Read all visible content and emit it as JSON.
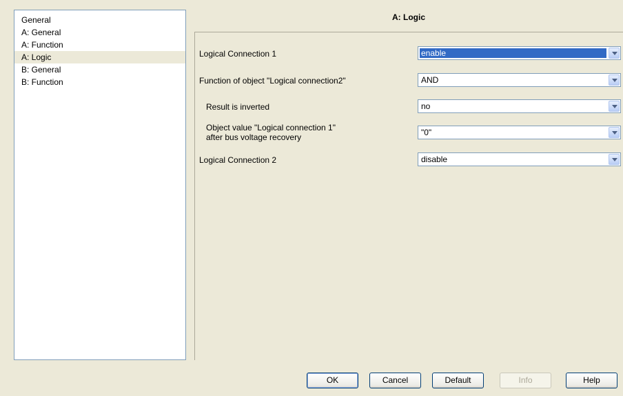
{
  "tree": {
    "items": [
      {
        "label": "General",
        "selected": false
      },
      {
        "label": "A: General",
        "selected": false
      },
      {
        "label": "A: Function",
        "selected": false
      },
      {
        "label": "A: Logic",
        "selected": true
      },
      {
        "label": "B: General",
        "selected": false
      },
      {
        "label": "B: Function",
        "selected": false
      }
    ]
  },
  "panel": {
    "title": "A: Logic",
    "params": [
      {
        "label": "Logical Connection 1",
        "value": "enable",
        "highlighted": true
      },
      {
        "label": "Function of object \"Logical connection2\"",
        "value": "AND"
      },
      {
        "label": "Result is inverted",
        "value": "no"
      },
      {
        "label_line1": "Object value \"Logical connection 1\"",
        "label_line2": "after bus voltage recovery",
        "value": "\"0\""
      },
      {
        "label": "Logical Connection 2",
        "value": "disable"
      }
    ]
  },
  "buttons": {
    "ok": "OK",
    "cancel": "Cancel",
    "default": "Default",
    "info": "Info",
    "help": "Help"
  },
  "colors": {
    "selection": "#316ac5",
    "background": "#ece9d8"
  }
}
